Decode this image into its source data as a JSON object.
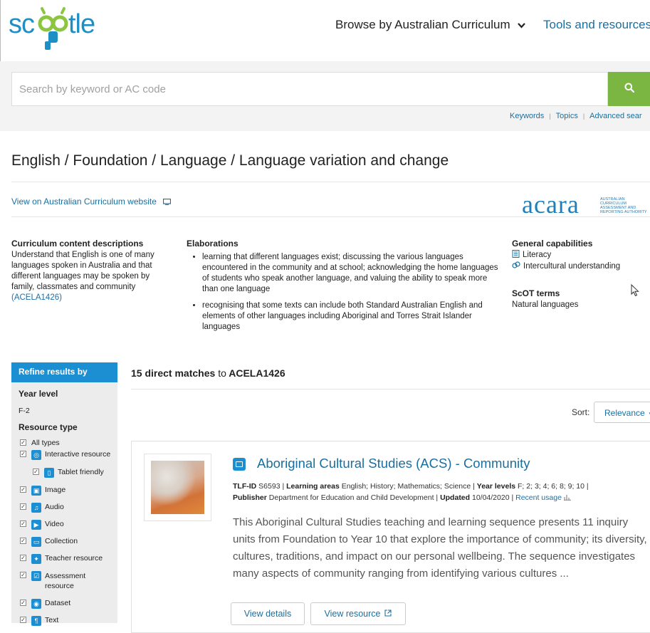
{
  "header": {
    "logo_text": "scootle",
    "nav_browse": "Browse by Australian Curriculum",
    "nav_tools": "Tools and resources"
  },
  "search": {
    "placeholder": "Search by keyword or AC code",
    "links": [
      "Keywords",
      "Topics",
      "Advanced sear"
    ]
  },
  "breadcrumb": "English / Foundation / Language / Language variation and change",
  "ac_link": "View on Australian Curriculum website",
  "acara": {
    "logo": "acara",
    "tagline": "AUSTRALIAN CURRICULUM ASSESSMENT AND REPORTING AUTHORITY"
  },
  "content_descriptions": {
    "heading": "Curriculum content descriptions",
    "text": "Understand that English is one of many languages spoken in Australia and that different languages may be spoken by family, classmates and community",
    "code": "(ACELA1426)"
  },
  "elaborations": {
    "heading": "Elaborations",
    "items": [
      "learning that different languages exist; discussing the various languages encountered in the community and at school; acknowledging the home languages of students who speak another language, and valuing the ability to speak more than one language",
      "recognising that some texts can include both Standard Australian English and elements of other languages including Aboriginal and Torres Strait Islander languages"
    ]
  },
  "capabilities": {
    "heading": "General capabilities",
    "items": [
      "Literacy",
      "Intercultural understanding"
    ]
  },
  "scot": {
    "heading": "ScOT terms",
    "value": "Natural languages"
  },
  "sidebar": {
    "title": "Refine results by",
    "year_level_label": "Year level",
    "year_level_value": "F-2",
    "resource_type_label": "Resource type",
    "types": [
      "All types",
      "Interactive resource",
      "Tablet friendly",
      "Image",
      "Audio",
      "Video",
      "Collection",
      "Teacher resource",
      "Assessment resource",
      "Dataset",
      "Text"
    ]
  },
  "results": {
    "count_text": "15 direct matches",
    "to_text": "to",
    "code": "ACELA1426",
    "sort_label": "Sort:",
    "sort_value": "Relevance"
  },
  "result": {
    "title": "Aboriginal Cultural Studies (ACS) - Community",
    "tlf_label": "TLF-ID",
    "tlf_value": "S6593",
    "areas_label": "Learning areas",
    "areas_value": "English; History; Mathematics; Science",
    "years_label": "Year levels",
    "years_value": "F; 2; 3; 4; 6; 8; 9; 10",
    "publisher_label": "Publisher",
    "publisher_value": "Department for Education and Child Development",
    "updated_label": "Updated",
    "updated_value": "10/04/2020",
    "recent_usage": "Recent usage",
    "description": "This Aboriginal Cultural Studies teaching and learning sequence presents 11 inquiry units from Foundation to Year 10 that explore the importance of community; its diversity, cultures, traditions, and impact on our personal wellbeing. The sequence investigates many aspects of community ranging from identifying various cultures ...",
    "view_details": "View details",
    "view_resource": "View resource"
  },
  "colors": {
    "brand_blue": "#1b8fd1",
    "brand_green": "#7ab641",
    "link": "#1a6fa0"
  }
}
